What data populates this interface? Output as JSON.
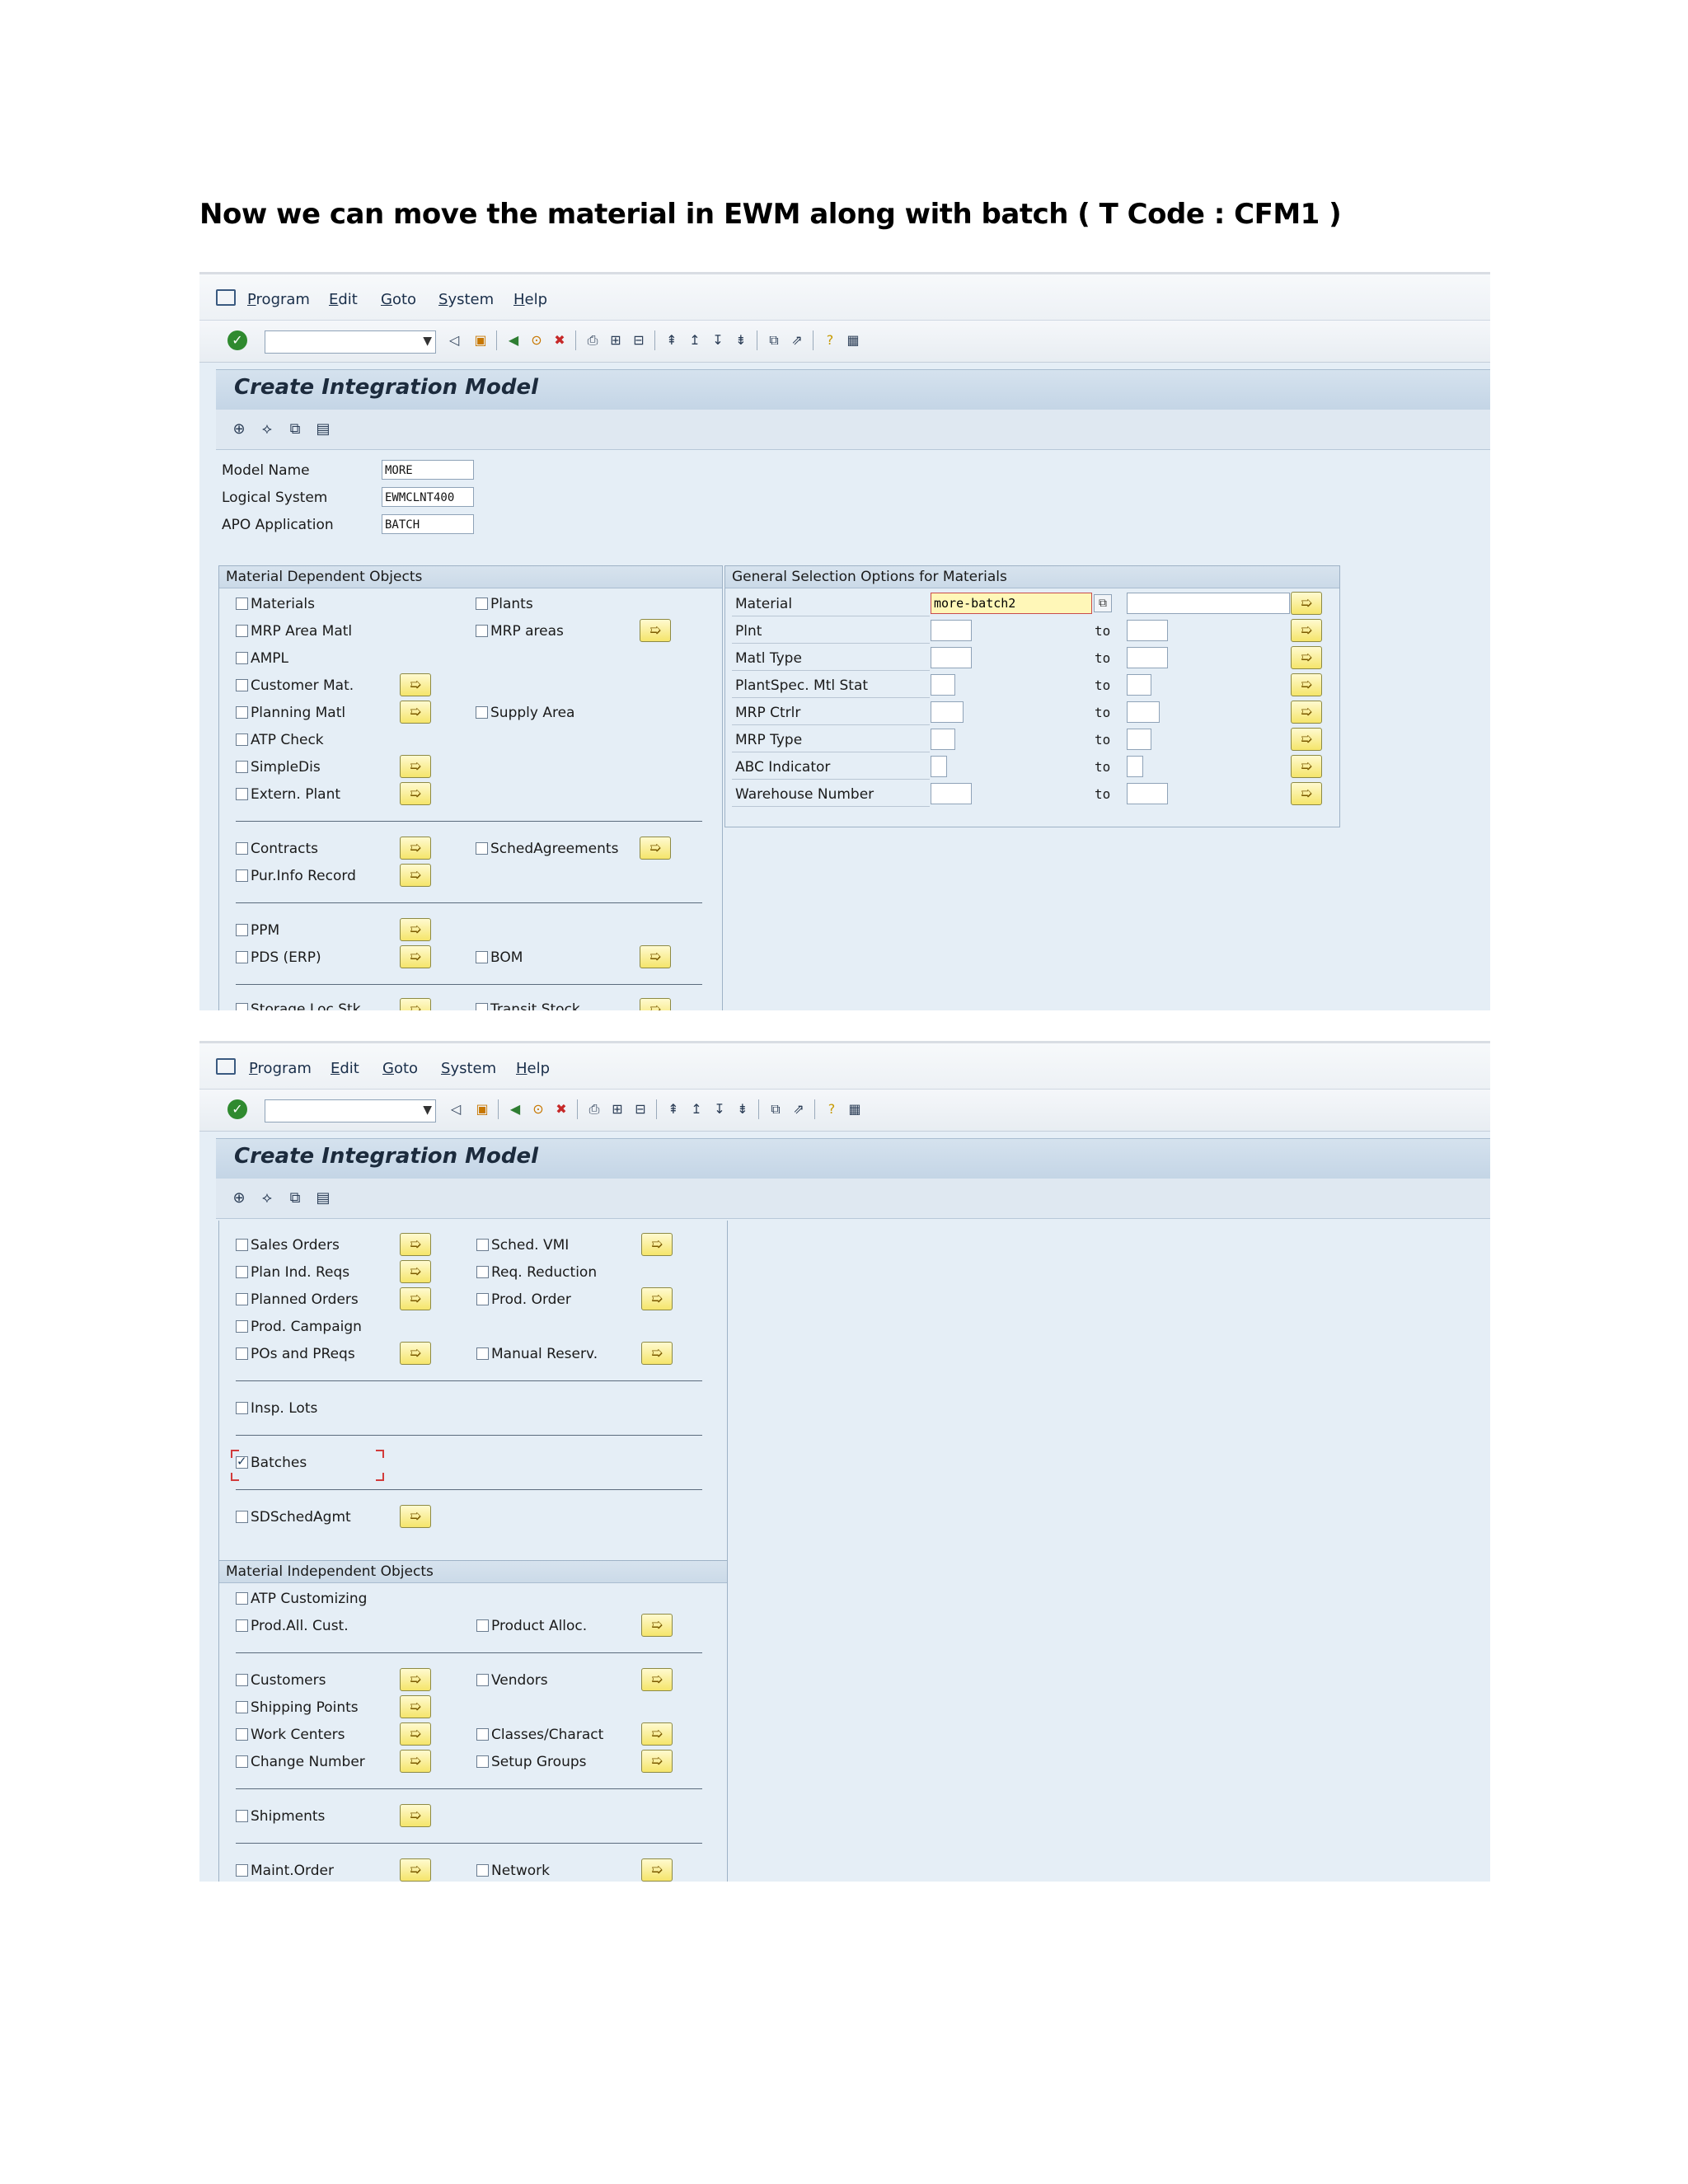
{
  "doc": {
    "title": "Now we can move the material in EWM along with batch ( T Code : CFM1 )"
  },
  "menu": {
    "items": [
      "Program",
      "Edit",
      "Goto",
      "System",
      "Help"
    ]
  },
  "screen": {
    "title": "Create Integration Model"
  },
  "header_fields": {
    "model_name_label": "Model Name",
    "model_name_value": "MORE",
    "logical_system_label": "Logical System",
    "logical_system_value": "EWMCLNT400",
    "apo_app_label": "APO Application",
    "apo_app_value": "BATCH"
  },
  "mdo": {
    "title": "Material Dependent Objects",
    "items": {
      "materials": "Materials",
      "plants": "Plants",
      "mrp_area_matl": "MRP Area Matl",
      "mrp_areas": "MRP areas",
      "ampl": "AMPL",
      "customer_mat": "Customer Mat.",
      "planning_matl": "Planning Matl",
      "supply_area": "Supply Area",
      "atp_check": "ATP Check",
      "simpledis": "SimpleDis",
      "extern_plant": "Extern. Plant",
      "contracts": "Contracts",
      "schedagreements": "SchedAgreements",
      "pur_info_record": "Pur.Info Record",
      "ppm": "PPM",
      "pds_erp": "PDS (ERP)",
      "bom": "BOM",
      "storage_loc_stk": "Storage Loc Stk",
      "transit_stock": "Transit Stock"
    }
  },
  "gso": {
    "title": "General Selection Options for Materials",
    "to": "to",
    "rows": [
      {
        "label": "Material",
        "value": "more-batch2"
      },
      {
        "label": "Plnt",
        "value": ""
      },
      {
        "label": "Matl Type",
        "value": ""
      },
      {
        "label": "PlantSpec. Mtl Stat",
        "value": ""
      },
      {
        "label": "MRP Ctrlr",
        "value": ""
      },
      {
        "label": "MRP Type",
        "value": ""
      },
      {
        "label": "ABC Indicator",
        "value": ""
      },
      {
        "label": "Warehouse Number",
        "value": ""
      }
    ]
  },
  "mdo2": {
    "sales_orders": "Sales Orders",
    "sched_vmi": "Sched. VMI",
    "plan_ind_reqs": "Plan Ind. Reqs",
    "req_reduction": "Req. Reduction",
    "planned_orders": "Planned Orders",
    "prod_order": "Prod. Order",
    "prod_campaign": "Prod. Campaign",
    "pos_preqs": "POs and PReqs",
    "manual_reserv": "Manual Reserv.",
    "insp_lots": "Insp. Lots",
    "batches": "Batches",
    "batches_checked": true,
    "sdschedagmt": "SDSchedAgmt"
  },
  "mio": {
    "title": "Material Independent Objects",
    "items": {
      "atp_customizing": "ATP Customizing",
      "prod_all_cust": "Prod.All. Cust.",
      "product_alloc": "Product Alloc.",
      "customers": "Customers",
      "vendors": "Vendors",
      "shipping_points": "Shipping Points",
      "work_centers": "Work Centers",
      "classes_charact": "Classes/Charact",
      "change_number": "Change Number",
      "setup_groups": "Setup Groups",
      "shipments": "Shipments",
      "maint_order": "Maint.Order",
      "network": "Network"
    }
  }
}
